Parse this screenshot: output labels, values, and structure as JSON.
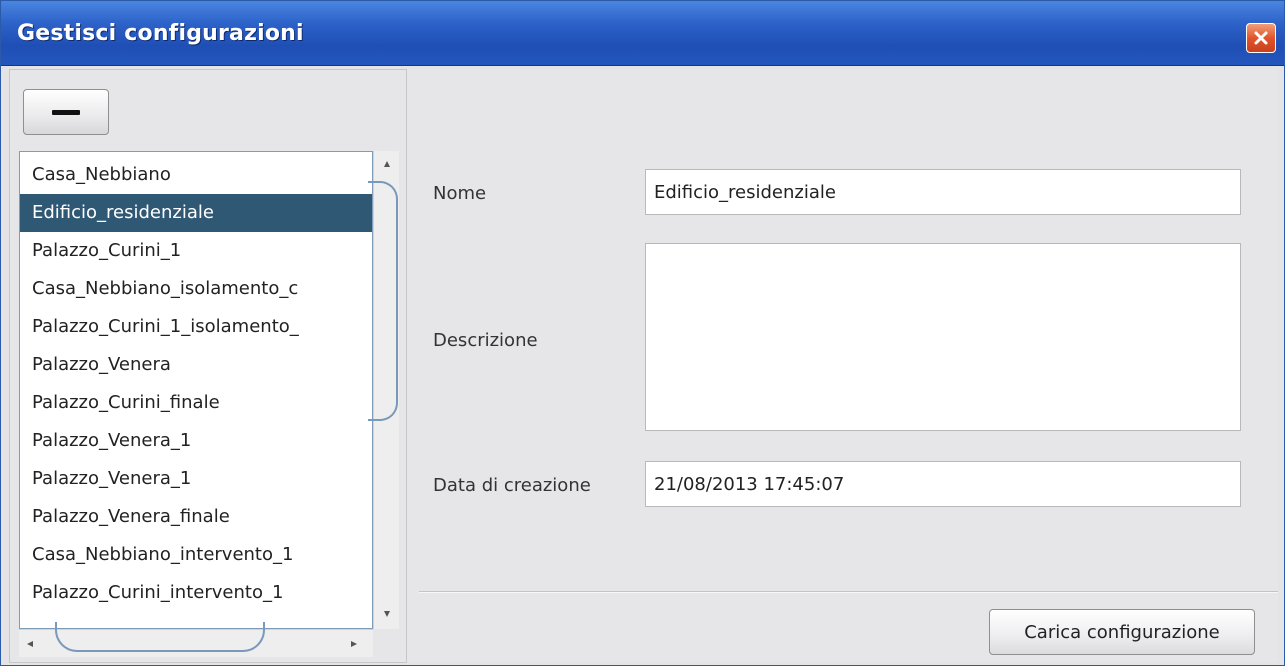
{
  "window": {
    "title": "Gestisci configurazioni"
  },
  "toolbar": {
    "remove_label": "—"
  },
  "configurations": {
    "selected_index": 1,
    "items": [
      "Casa_Nebbiano",
      "Edificio_residenziale",
      "Palazzo_Curini_1",
      "Casa_Nebbiano_isolamento_c",
      "Palazzo_Curini_1_isolamento_",
      "Palazzo_Venera",
      "Palazzo_Curini_finale",
      "Palazzo_Venera_1",
      "Palazzo_Venera_1",
      "Palazzo_Venera_finale",
      "Casa_Nebbiano_intervento_1",
      "Palazzo_Curini_intervento_1"
    ]
  },
  "details": {
    "name_label": "Nome",
    "name_value": "Edificio_residenziale",
    "description_label": "Descrizione",
    "description_value": "",
    "date_label": "Data di creazione",
    "date_value": "21/08/2013 17:45:07"
  },
  "actions": {
    "load_label": "Carica configurazione"
  },
  "colors": {
    "titlebar": "#2d62c9",
    "selection": "#2f5874",
    "close_button": "#e2552b",
    "scroll_thumb_border": "#7a98ba"
  },
  "icons": {
    "close": "close-icon",
    "remove": "minus-icon",
    "scroll_up": "arrow-up-icon",
    "scroll_down": "arrow-down-icon",
    "scroll_left": "arrow-left-icon",
    "scroll_right": "arrow-right-icon"
  }
}
